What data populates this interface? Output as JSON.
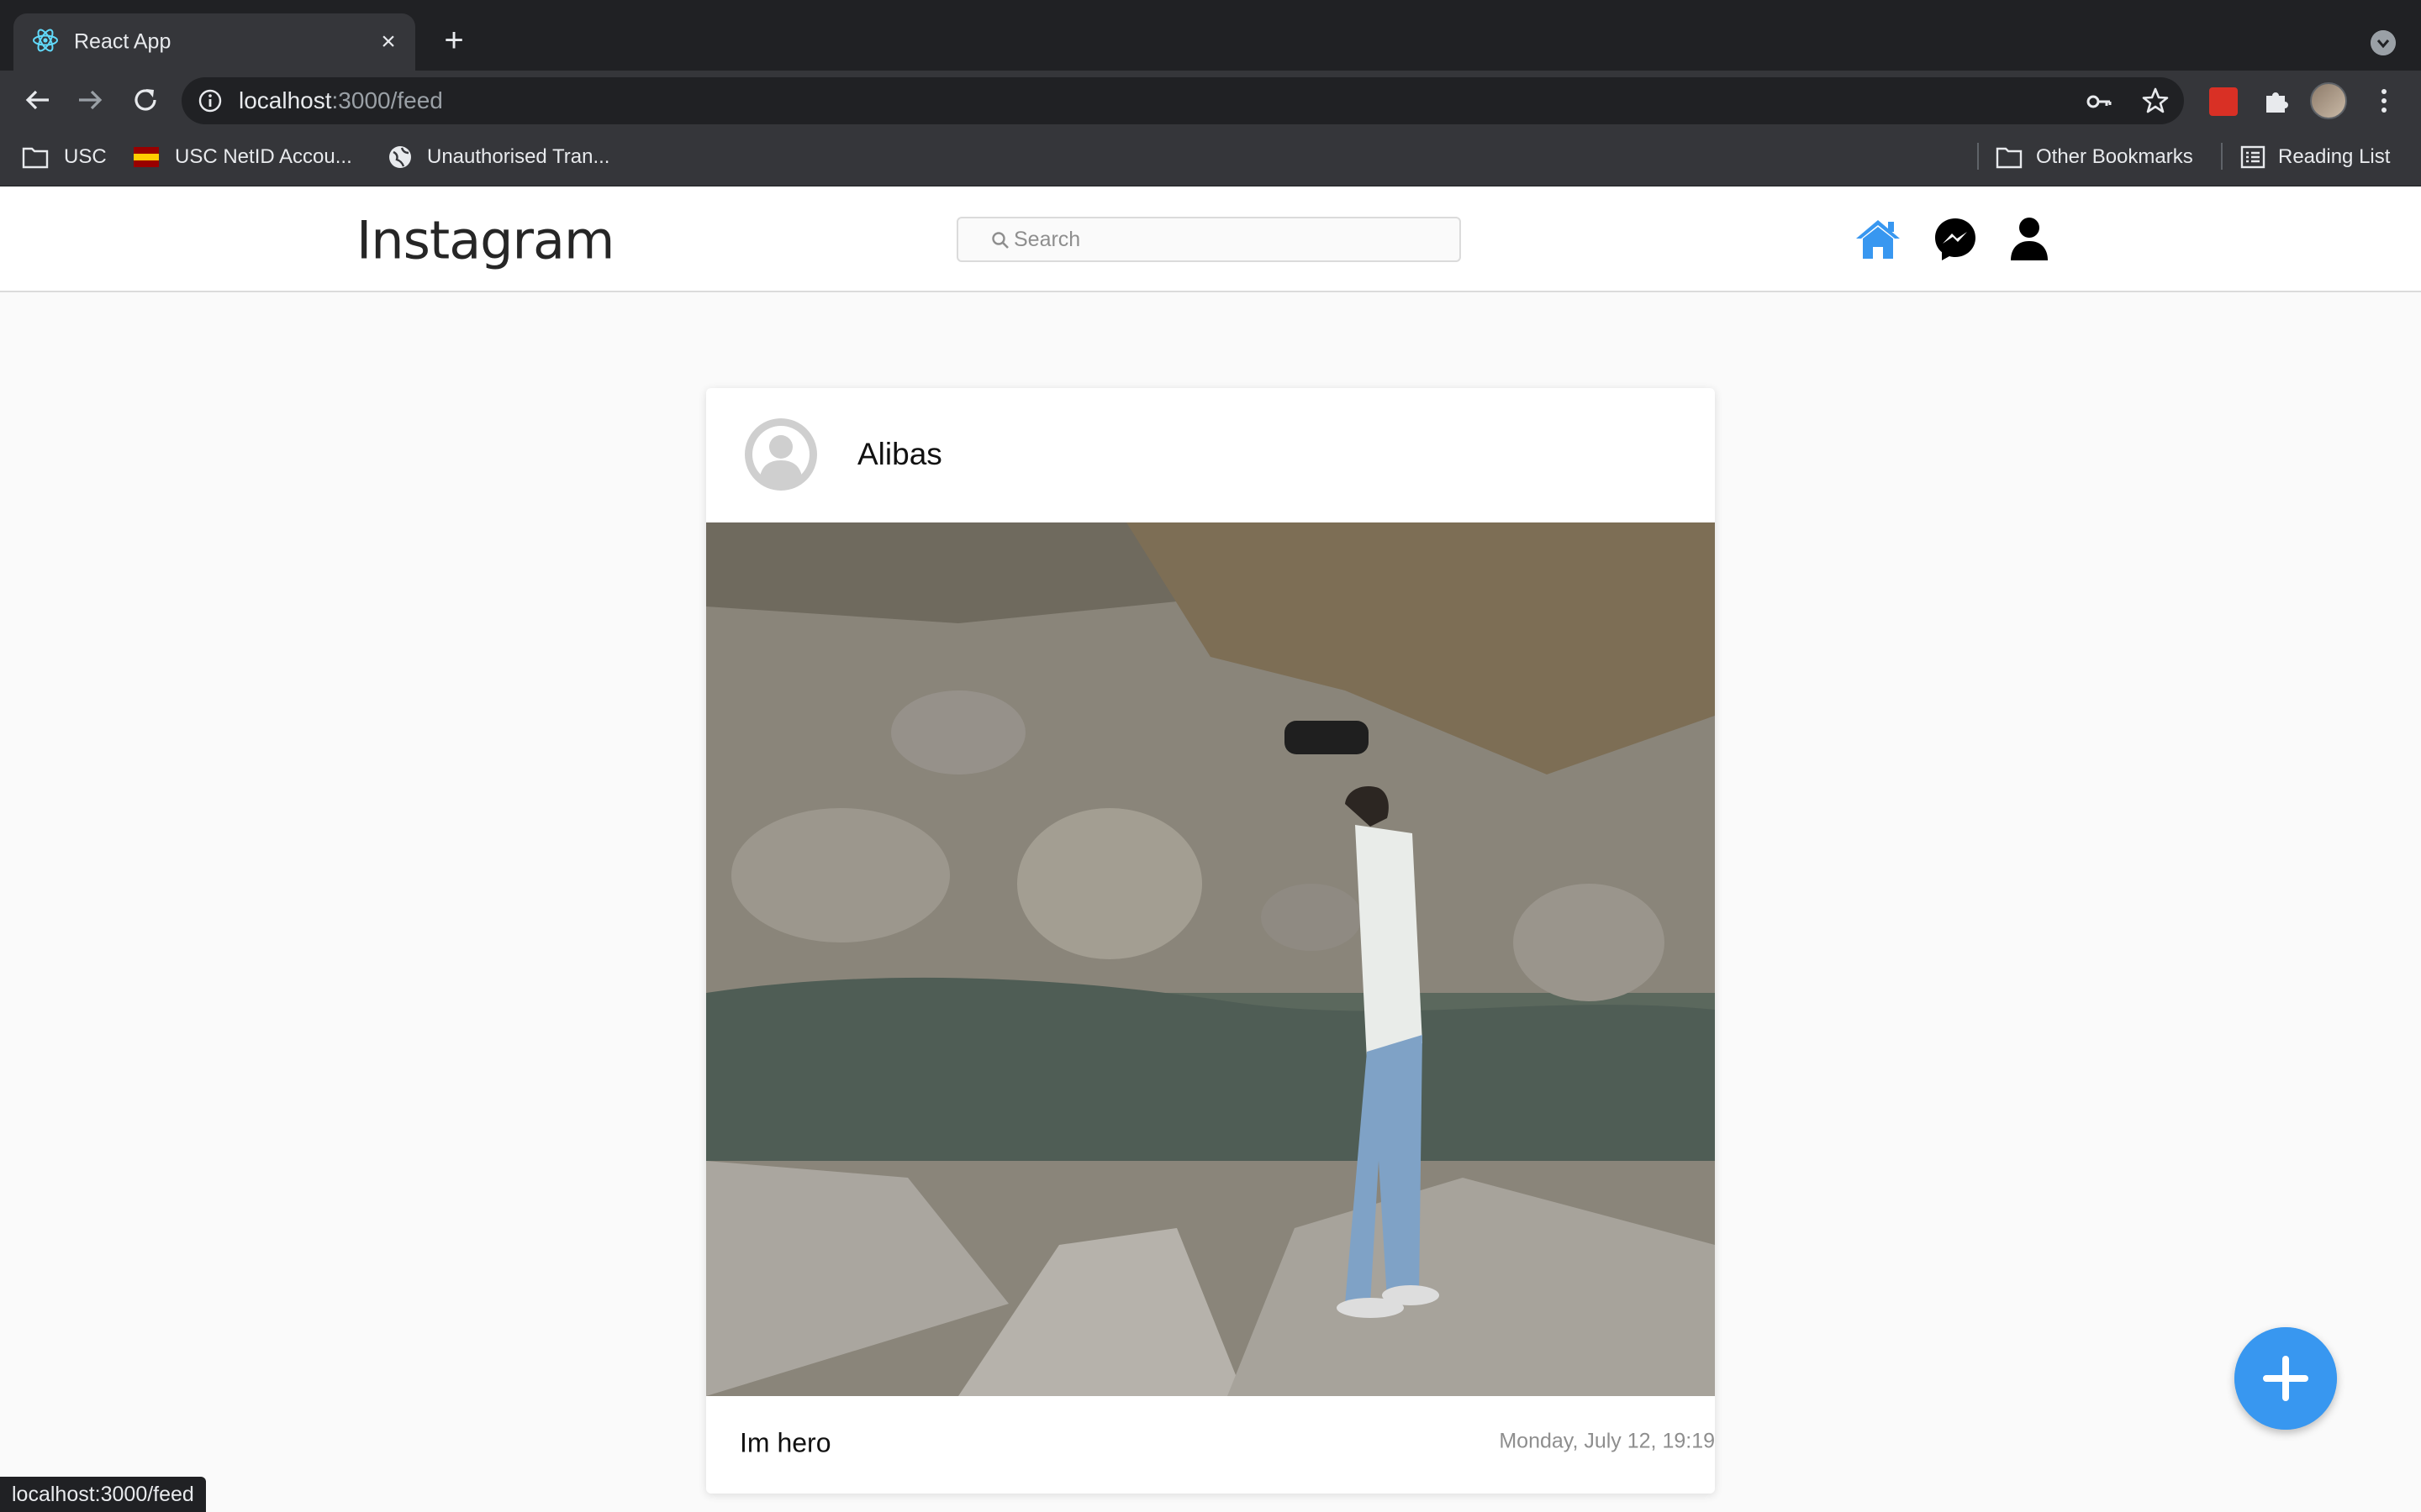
{
  "browser": {
    "tab": {
      "title": "React App"
    },
    "address": {
      "host": "localhost",
      "path": ":3000/feed"
    },
    "bookmarks": [
      {
        "label": "USC"
      },
      {
        "label": "USC NetID Accou..."
      },
      {
        "label": "Unauthorised Tran..."
      }
    ],
    "other_bookmarks": "Other Bookmarks",
    "reading_list": "Reading List",
    "status_url": "localhost:3000/feed"
  },
  "header": {
    "logo": "Instagram",
    "search_placeholder": "Search"
  },
  "post": {
    "username": "Alibas",
    "caption": "Im hero",
    "timestamp": "Monday, July 12, 19:19"
  },
  "colors": {
    "accent": "#3897f0",
    "home_icon": "#3897f0",
    "nav_icons": "#000000"
  }
}
